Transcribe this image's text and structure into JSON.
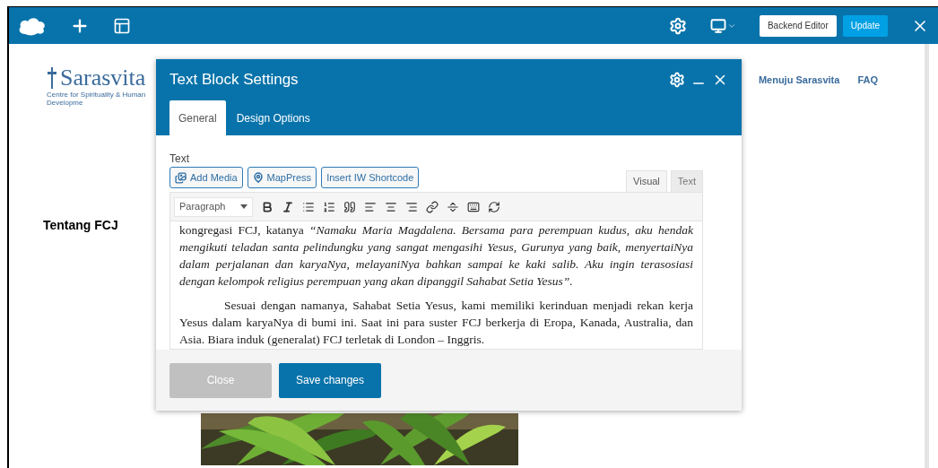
{
  "top_bar": {
    "buttons": [
      {
        "label": "Backend Editor",
        "kind": "secondary"
      },
      {
        "label": "Update",
        "kind": "primary"
      }
    ]
  },
  "site": {
    "logo_name": "Sarasvita",
    "logo_tagline": "Centre for Spirituality & Human Developme",
    "nav": [
      "Menuju Sarasvita",
      "FAQ"
    ],
    "heading": "Tentang FCJ"
  },
  "modal": {
    "title": "Text Block Settings",
    "tabs": [
      {
        "label": "General",
        "selected": true
      },
      {
        "label": "Design Options",
        "selected": false
      }
    ],
    "field_label": "Text",
    "media_buttons": [
      "Add Media",
      "MapPress",
      "Insert IW Shortcode"
    ],
    "editor_tabs": [
      {
        "label": "Visual",
        "selected": true
      },
      {
        "label": "Text",
        "selected": false
      }
    ],
    "format_select": "Paragraph",
    "paragraphs": [
      {
        "text": "kongregasi FCJ,  katanya *“Namaku Maria Magdalena. Bersama para perempuan kudus, aku hendak mengikuti teladan santa pelindungku yang sangat mengasihi Yesus, Gurunya yang baik, menyertaiNya dalam perjalanan dan karyaNya, melayaniNya bahkan sampai ke kaki salib.  Aku ingin terasosiasi dengan kelompok religius perempuan yang akan dipanggil Sahabat Setia Yesus”.*",
        "indent": false
      },
      {
        "text": "Sesuai dengan namanya, Sahabat Setia Yesus, kami memiliki kerinduan menjadi rekan kerja Yesus dalam karyaNya di bumi ini.  Saat ini para suster FCJ berkerja di Eropa, Kanada, Australia, dan Asia.  Biara induk (generalat) FCJ terletak di London – Inggris.",
        "indent": true
      }
    ],
    "footer_buttons": [
      {
        "label": "Close",
        "kind": "secondary"
      },
      {
        "label": "Save changes",
        "kind": "primary"
      }
    ]
  }
}
